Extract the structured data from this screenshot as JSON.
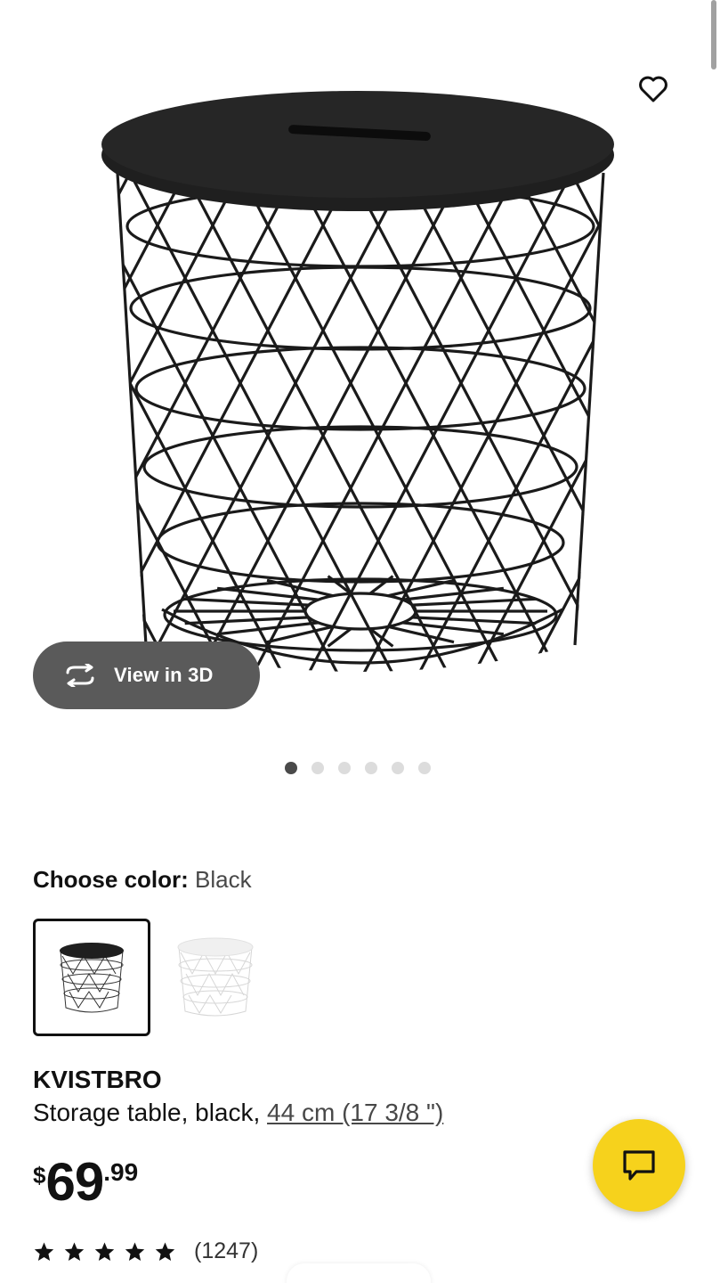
{
  "gallery": {
    "image_alt": "KVISTBRO storage table",
    "view3d_label": "View in 3D",
    "dots_count": 6,
    "active_dot": 0
  },
  "color": {
    "label": "Choose color:",
    "value": "Black",
    "options": [
      "black",
      "white"
    ],
    "selected": "black"
  },
  "product": {
    "name": "KVISTBRO",
    "desc_prefix": "Storage table, black, ",
    "size_link": "44 cm (17 3/8 \")"
  },
  "price": {
    "currency": "$",
    "integer": "69",
    "decimal": ".99"
  },
  "rating": {
    "stars": 5,
    "count": "(1247)"
  },
  "colors": {
    "accent_yellow": "#f6d21c",
    "pill_bg": "#5a5a5a",
    "text": "#111111"
  },
  "icons": {
    "favorite": "heart-icon",
    "view3d": "rotate-3d-icon",
    "chat": "chat-icon",
    "star": "star-icon"
  }
}
